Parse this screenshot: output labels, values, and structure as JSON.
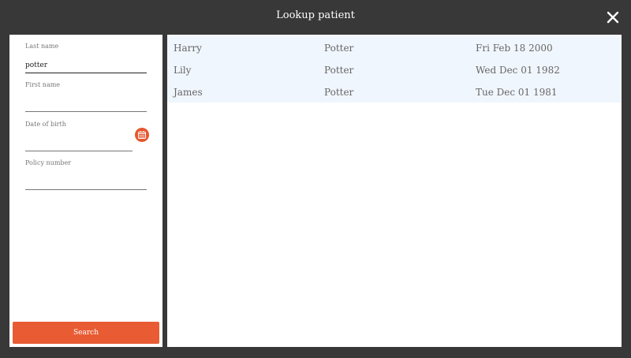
{
  "window": {
    "title": "Lookup patient",
    "close_icon": "close-icon"
  },
  "form": {
    "last_name_label": "Last name",
    "last_name_value": "potter",
    "first_name_label": "First name",
    "first_name_value": "",
    "dob_label": "Date of birth",
    "dob_value": "",
    "dob_icon": "calendar-icon",
    "policy_label": "Policy number",
    "policy_value": "",
    "search_label": "Search"
  },
  "results": [
    {
      "first": "Harry",
      "last": "Potter",
      "dob": "Fri Feb 18 2000"
    },
    {
      "first": "Lily",
      "last": "Potter",
      "dob": "Wed Dec 01 1982"
    },
    {
      "first": "James",
      "last": "Potter",
      "dob": "Tue Dec 01 1981"
    }
  ],
  "colors": {
    "accent": "#e95b33",
    "row_bg": "#f0f6fd",
    "chrome": "#383838"
  }
}
